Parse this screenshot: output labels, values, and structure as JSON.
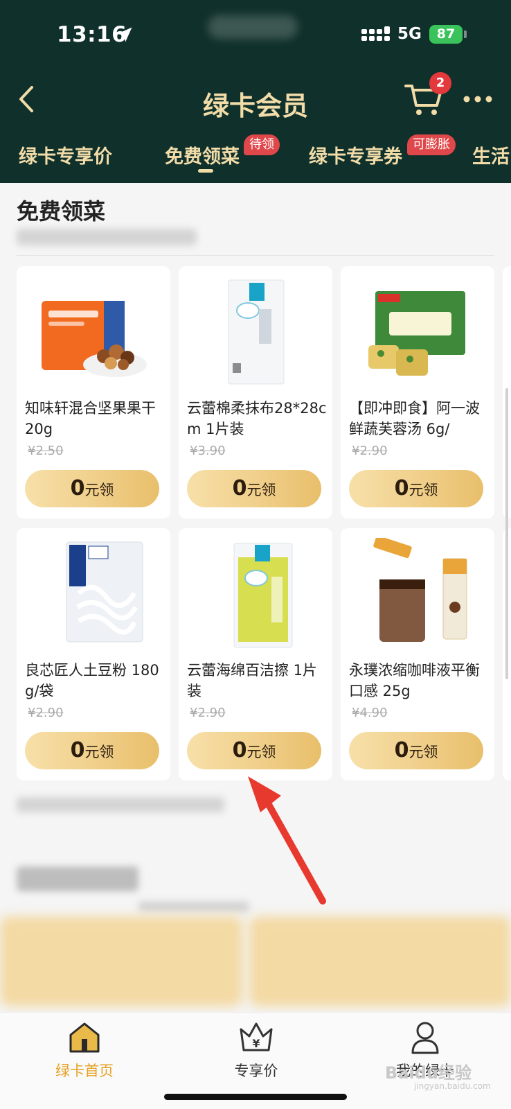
{
  "status_bar": {
    "time": "13:16",
    "network": "5G",
    "battery": "87"
  },
  "nav": {
    "title": "绿卡会员",
    "cart_count": "2"
  },
  "tabs": [
    {
      "label": "绿卡专享价"
    },
    {
      "label": "免费领菜",
      "badge": "待领",
      "active": true
    },
    {
      "label": "绿卡专享券",
      "badge": "可膨胀"
    },
    {
      "label": "生活"
    }
  ],
  "section": {
    "title": "免费领菜"
  },
  "claim_button": {
    "amount": "0",
    "suffix": "元领"
  },
  "products": [
    {
      "name": "知味轩混合坚果果干 20g",
      "price": "¥2.50"
    },
    {
      "name": "云蕾棉柔抹布28*28cm 1片装",
      "price": "¥3.90"
    },
    {
      "name": "【即冲即食】阿一波鲜蔬芙蓉汤 6g/",
      "price": "¥2.90"
    },
    {
      "name": "良芯匠人土豆粉 180g/袋",
      "price": "¥2.90"
    },
    {
      "name": "云蕾海绵百洁擦 1片装",
      "price": "¥2.90"
    },
    {
      "name": "永璞浓缩咖啡液平衡口感 25g",
      "price": "¥4.90"
    }
  ],
  "bottom_nav": [
    {
      "label": "绿卡首页",
      "icon": "home-icon",
      "active": true
    },
    {
      "label": "专享价",
      "icon": "crown-yuan-icon"
    },
    {
      "label": "我的绿卡",
      "icon": "user-icon"
    }
  ],
  "watermark": {
    "text": "Baidu经验",
    "sub": "jingyan.baidu.com"
  },
  "colors": {
    "header_bg": "#10302c",
    "gold": "#f2dca8",
    "badge_red": "#e0474a",
    "active_tab": "#e5a224"
  }
}
